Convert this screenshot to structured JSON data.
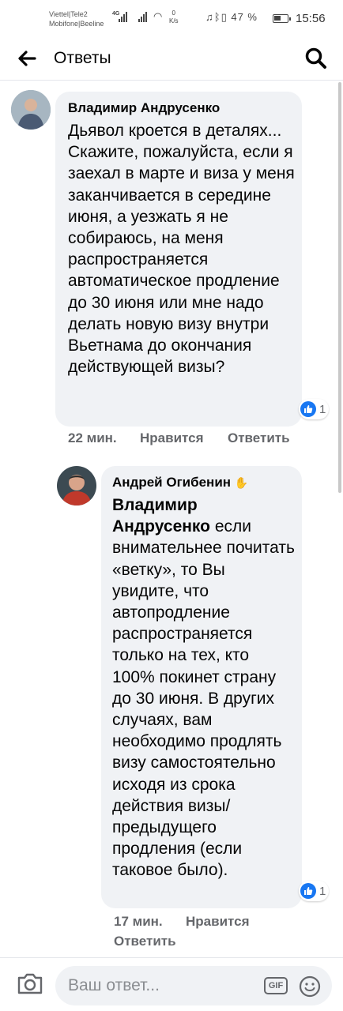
{
  "status_bar": {
    "carrier_line1": "Viettel|Tele2",
    "carrier_line2": "Mobifone|Beeline",
    "network": "4G",
    "speed_value": "0",
    "speed_unit": "K/s",
    "battery": "47 %",
    "time": "15:56"
  },
  "header": {
    "title": "Ответы"
  },
  "comments": [
    {
      "author": "Владимир Андрусенко",
      "text": "Дьявол кроется в деталях... Скажите, пожалуйста, если я заехал в марте и виза у меня заканчивается в середине июня, а уезжать я не собираюсь, на меня распространяется автоматическое продление до 30 июня или мне надо делать новую визу внутри Вьетнама до окончания действующей визы?",
      "reaction_count": "1",
      "time": "22 мин.",
      "like_label": "Нравится",
      "reply_label": "Ответить"
    },
    {
      "author": "Андрей Огибенин",
      "mention": "Владимир Андрусенко",
      "text": " если внимательнее почитать «ветку», то Вы увидите, что автопродление распространяется только на тех, кто 100% покинет страну до 30 июня. В других случаях, вам необходимо продлять визу самостоятельно исходя из срока действия визы/предыдущего продления (если таковое было).",
      "reaction_count": "1",
      "time": "17 мин.",
      "like_label": "Нравится",
      "reply_label": "Ответить"
    }
  ],
  "composer": {
    "placeholder": "Ваш ответ...",
    "gif_label": "GIF"
  },
  "colors": {
    "bubble": "#f0f2f5",
    "meta": "#65676b",
    "like_blue": "#1877f2"
  },
  "icons": [
    "back-arrow-icon",
    "search-icon",
    "camera-icon",
    "gif-icon",
    "emoji-icon",
    "like-icon",
    "waving-hand-icon"
  ]
}
